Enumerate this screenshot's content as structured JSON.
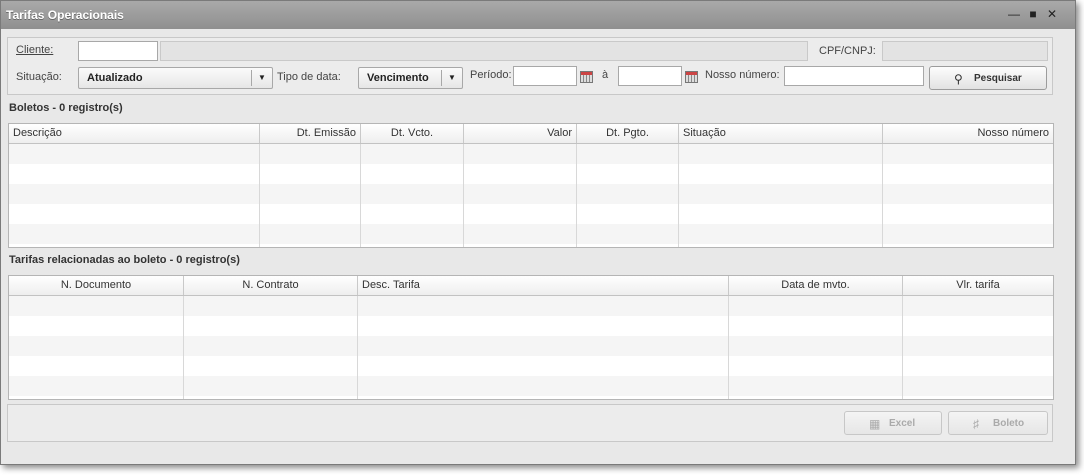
{
  "window": {
    "title": "Tarifas Operacionais"
  },
  "filters": {
    "cliente_label": "Cliente:",
    "cliente_code": "",
    "cliente_name": "",
    "cpf_label": "CPF/CNPJ:",
    "cpf_value": "",
    "situacao_label": "Situação:",
    "situacao_value": "Atualizado",
    "tipo_data_label": "Tipo de data:",
    "tipo_data_value": "Vencimento",
    "periodo_label": "Período:",
    "periodo_from": "",
    "periodo_sep": "à",
    "periodo_to": "",
    "nosso_numero_label": "Nosso número:",
    "nosso_numero_value": "",
    "pesquisar_label": "Pesquisar"
  },
  "boletos": {
    "title": "Boletos - 0 registro(s)",
    "columns": [
      "Descrição",
      "Dt. Emissão",
      "Dt. Vcto.",
      "Valor",
      "Dt. Pgto.",
      "Situação",
      "Nosso número"
    ],
    "rows": []
  },
  "tarifas": {
    "title": "Tarifas relacionadas ao boleto - 0 registro(s)",
    "columns": [
      "N. Documento",
      "N. Contrato",
      "Desc. Tarifa",
      "Data de mvto.",
      "Vlr. tarifa"
    ],
    "rows": []
  },
  "footer": {
    "excel_label": "Excel",
    "boleto_label": "Boleto"
  },
  "icons": {
    "minimize": "minimize-icon",
    "maximize": "maximize-icon",
    "close": "close-icon",
    "search": "search-icon",
    "calendar": "calendar-icon",
    "excel": "excel-icon",
    "pdf": "pdf-icon"
  }
}
